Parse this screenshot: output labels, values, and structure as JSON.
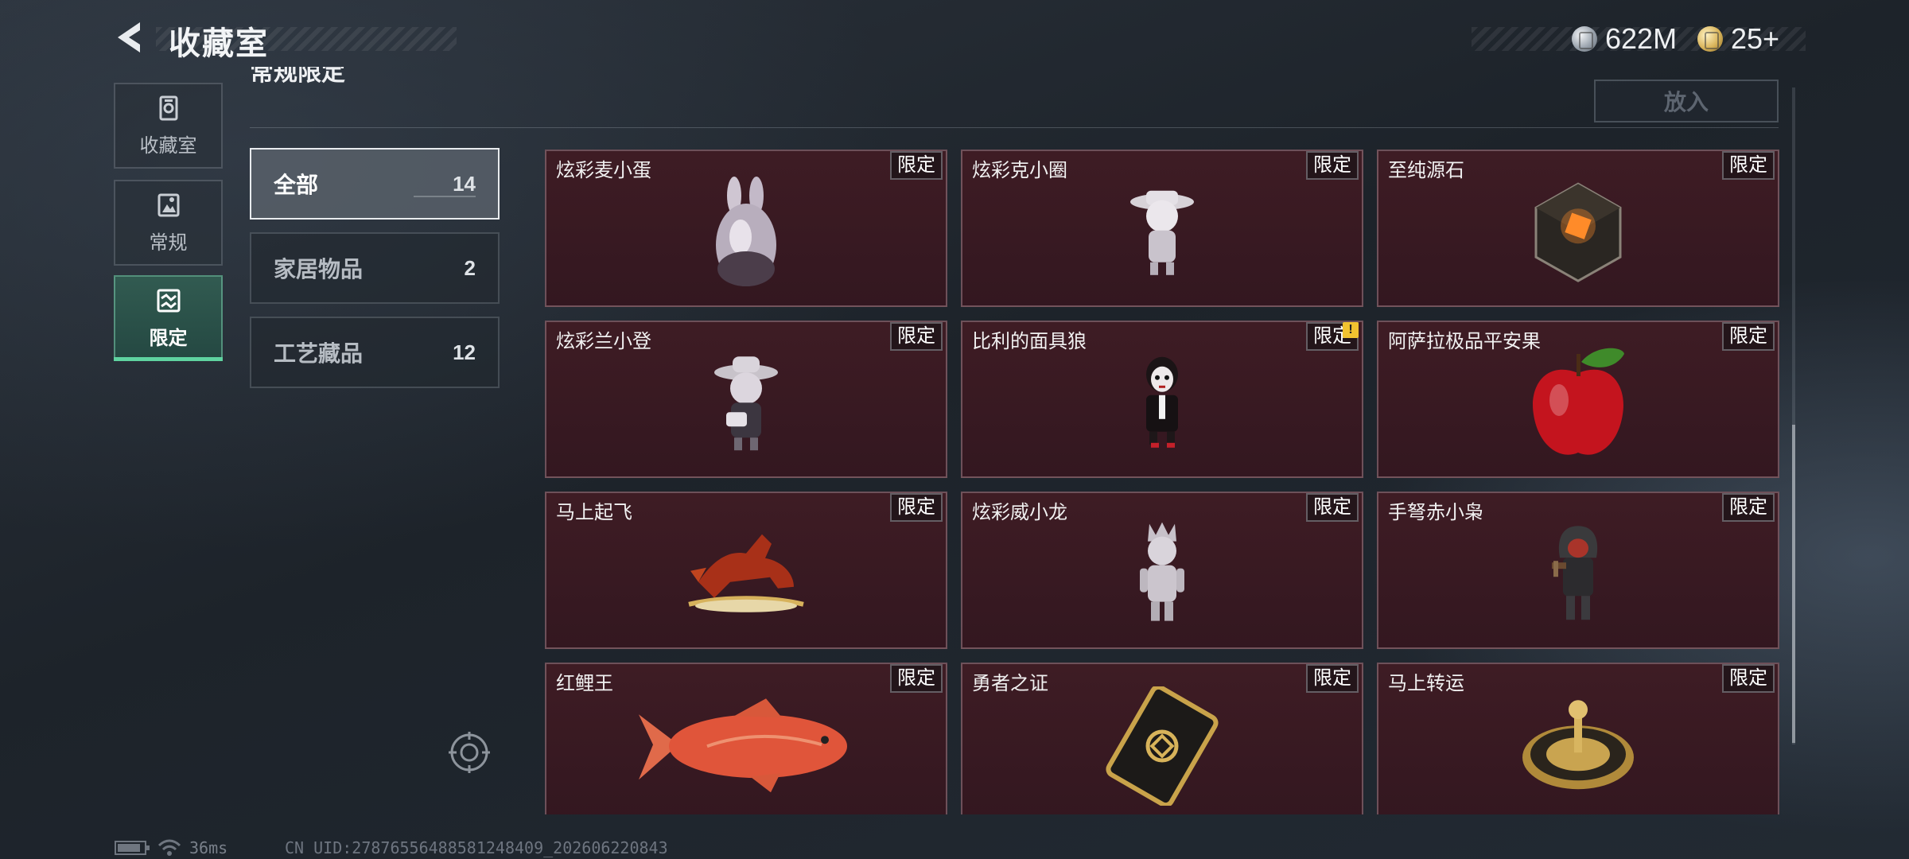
{
  "header": {
    "title": "收藏室"
  },
  "currencies": [
    {
      "icon": "silver-coin-icon",
      "value": "622M"
    },
    {
      "icon": "gold-coin-icon",
      "value": "25+"
    }
  ],
  "sidebar": {
    "items": [
      {
        "label": "收藏室",
        "icon": "collection-room-icon",
        "active": false
      },
      {
        "label": "常规",
        "icon": "regular-icon",
        "active": false
      },
      {
        "label": "限定",
        "icon": "limited-icon",
        "active": true
      }
    ]
  },
  "section": {
    "title": "常规限定",
    "put_button": "放入"
  },
  "categories": [
    {
      "name": "全部",
      "count": "14",
      "active": true
    },
    {
      "name": "家居物品",
      "count": "2",
      "active": false
    },
    {
      "name": "工艺藏品",
      "count": "12",
      "active": false
    }
  ],
  "items": [
    {
      "name": "炫彩麦小蛋",
      "tag": "限定",
      "icon": "bunny-egg-figure-icon"
    },
    {
      "name": "炫彩克小圈",
      "tag": "限定",
      "icon": "hat-girl-figure-icon"
    },
    {
      "name": "至纯源石",
      "tag": "限定",
      "icon": "ore-crystal-icon"
    },
    {
      "name": "炫彩兰小登",
      "tag": "限定",
      "icon": "sombrero-figure-icon"
    },
    {
      "name": "比利的面具狼",
      "tag": "限定",
      "icon": "puppet-mask-figure-icon",
      "alert": "!"
    },
    {
      "name": "阿萨拉极品平安果",
      "tag": "限定",
      "icon": "red-apple-icon"
    },
    {
      "name": "马上起飞",
      "tag": "限定",
      "icon": "red-horse-icon"
    },
    {
      "name": "炫彩威小龙",
      "tag": "限定",
      "icon": "dragon-figure-icon"
    },
    {
      "name": "手弩赤小枭",
      "tag": "限定",
      "icon": "hooded-figure-icon"
    },
    {
      "name": "红鲤王",
      "tag": "限定",
      "icon": "red-carp-icon"
    },
    {
      "name": "勇者之证",
      "tag": "限定",
      "icon": "gold-card-icon"
    },
    {
      "name": "马上转运",
      "tag": "限定",
      "icon": "gold-turntable-icon"
    }
  ],
  "status_bar": {
    "ping": "36ms",
    "uid": "CN UID:2787655648858124840­9_202606220843"
  },
  "colors": {
    "accent": "#5fd3a0",
    "card_bg": "#3a1a22",
    "alert": "#f2c230"
  }
}
